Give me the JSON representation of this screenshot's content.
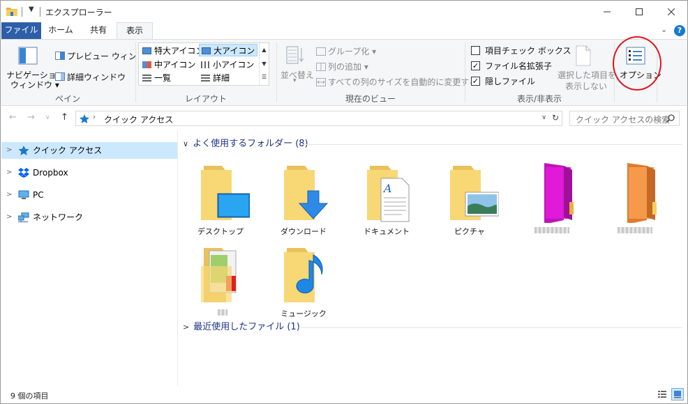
{
  "window": {
    "title": "エクスプローラー",
    "minimize_icon": "minimize-icon",
    "maximize_icon": "maximize-icon",
    "close_icon": "close-icon"
  },
  "tabs": [
    {
      "label": "ファイル"
    },
    {
      "label": "ホーム"
    },
    {
      "label": "共有"
    },
    {
      "label": "表示"
    }
  ],
  "ribbon": {
    "panes": {
      "nav_pane_line1": "ナビゲーション",
      "nav_pane_line2": "ウィンドウ",
      "preview": "プレビュー ウィンドウ",
      "details": "詳細ウィンドウ",
      "label": "ペイン"
    },
    "layout": {
      "items": [
        "特大アイコン",
        "大アイコン",
        "中アイコン",
        "小アイコン",
        "一覧",
        "詳細"
      ],
      "selected": "大アイコン",
      "label": "レイアウト"
    },
    "current_view": {
      "sort_line1": "並べ替え",
      "group": "グループ化",
      "add_column": "列の追加",
      "autosize": "すべての列のサイズを自動的に変更する",
      "label": "現在のビュー"
    },
    "show_hide": {
      "item_checkbox": "項目チェック ボックス",
      "extensions": "ファイル名拡張子",
      "hidden": "隠しファイル",
      "hide_selected_line1": "選択した項目を",
      "hide_selected_line2": "表示しない",
      "label": "表示/非表示",
      "checked": [
        false,
        true,
        true
      ]
    },
    "options": {
      "label": "オプション"
    }
  },
  "address": {
    "path": "クイック アクセス",
    "search_placeholder": "クイック アクセスの検索"
  },
  "nav": {
    "items": [
      {
        "label": "クイック アクセス",
        "icon": "star-icon"
      },
      {
        "label": "Dropbox",
        "icon": "dropbox-icon"
      },
      {
        "label": "PC",
        "icon": "pc-icon"
      },
      {
        "label": "ネットワーク",
        "icon": "network-icon"
      }
    ]
  },
  "content": {
    "frequent_header": "よく使用するフォルダー (8)",
    "recent_header": "最近使用したファイル (1)",
    "folders": [
      {
        "label": "デスクトップ",
        "icon": "desktop-folder-icon"
      },
      {
        "label": "ダウンロード",
        "icon": "download-folder-icon"
      },
      {
        "label": "ドキュメント",
        "icon": "documents-folder-icon"
      },
      {
        "label": "ピクチャ",
        "icon": "pictures-folder-icon"
      },
      {
        "label": "",
        "icon": "magenta-folder-icon"
      },
      {
        "label": "",
        "icon": "orange-folder-icon"
      },
      {
        "label": "",
        "icon": "image-folder-icon"
      },
      {
        "label": "ミュージック",
        "icon": "music-folder-icon"
      }
    ]
  },
  "status": {
    "count": "9 個の項目"
  },
  "colors": {
    "accent": "#1979ca",
    "selection": "#cce8ff",
    "callout": "#e0141e"
  }
}
